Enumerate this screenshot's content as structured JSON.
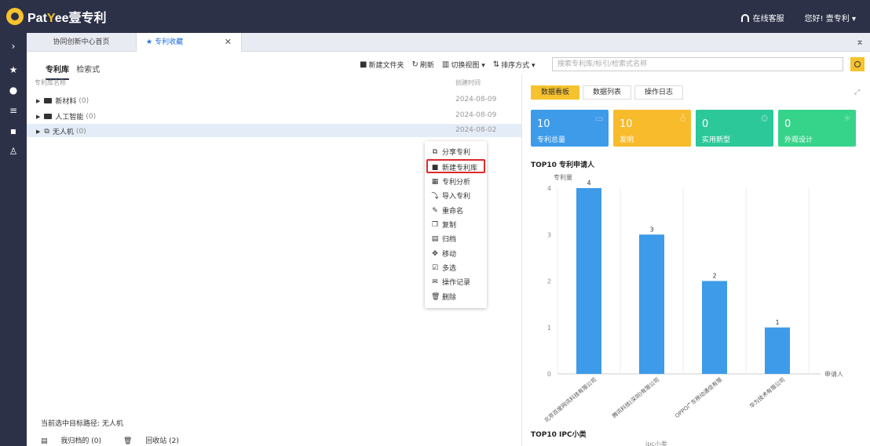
{
  "header": {
    "logo_text_1": "Pat",
    "logo_text_y": "Y",
    "logo_text_2": "ee壹专利",
    "service": "在线客服",
    "greeting": "您好! 壹专利 ▾"
  },
  "tabs": [
    {
      "label": "协同创新中心首页"
    },
    {
      "label": "专利收藏"
    }
  ],
  "library_tabs": {
    "active": "专利库",
    "other": "检索式"
  },
  "toolbar": {
    "new_folder": "新建文件夹",
    "refresh": "刷新",
    "switch_view": "切换视图 ▾",
    "sort": "排序方式 ▾"
  },
  "search": {
    "placeholder": "搜索专利库/标引/检索式名称"
  },
  "table": {
    "col_name": "专利库名称",
    "col_date": "创建时间",
    "rows": [
      {
        "name": "新材料",
        "count": "(0)",
        "date": "2024-08-09"
      },
      {
        "name": "人工智能",
        "count": "(0)",
        "date": "2024-08-09"
      },
      {
        "name": "无人机",
        "count": "(0)",
        "date": "2024-08-02"
      }
    ]
  },
  "context_menu": {
    "items": [
      {
        "label": "分享专利",
        "icon": "share-icon"
      },
      {
        "label": "新建专利库",
        "icon": "folder-icon"
      },
      {
        "label": "专利分析",
        "icon": "chart-icon"
      },
      {
        "label": "导入专利",
        "icon": "import-icon"
      },
      {
        "label": "重命名",
        "icon": "rename-icon"
      },
      {
        "label": "复制",
        "icon": "copy-icon"
      },
      {
        "label": "归档",
        "icon": "archive-icon"
      },
      {
        "label": "移动",
        "icon": "move-icon"
      },
      {
        "label": "多选",
        "icon": "multiselect-icon"
      },
      {
        "label": "操作记录",
        "icon": "log-icon"
      },
      {
        "label": "删除",
        "icon": "trash-icon"
      }
    ],
    "highlighted": "新建专利库"
  },
  "footer": {
    "path": "当前选中目标路径:  无人机",
    "archived": "我归档的 (0)",
    "recycle": "回收站 (2)"
  },
  "right_panel": {
    "tabs": [
      "数据看板",
      "数据列表",
      "操作日志"
    ],
    "cards": [
      {
        "value": "10",
        "label": "专利总量",
        "color": "#3d9be9"
      },
      {
        "value": "10",
        "label": "发明",
        "color": "#f8bb2c"
      },
      {
        "value": "0",
        "label": "实用新型",
        "color": "#2cc89a"
      },
      {
        "value": "0",
        "label": "外观设计",
        "color": "#36d38a"
      }
    ],
    "chart_title": "TOP10 专利申请人",
    "chart2_title": "TOP10 IPC小类",
    "chart2_sub": "ipc小类"
  },
  "chart_data": {
    "type": "bar",
    "categories": [
      "北京百度网讯科技有限公司",
      "腾讯科技(深圳)有限公司",
      "OPPO广东移动通信有限公司",
      "华为技术有限公司"
    ],
    "values": [
      4,
      3,
      2,
      1
    ],
    "ylabel": "专利量",
    "xlabel": "申请人",
    "ylim": [
      0,
      4
    ],
    "yticks": [
      0,
      1,
      2,
      3,
      4
    ],
    "color": "#3d9be9"
  }
}
